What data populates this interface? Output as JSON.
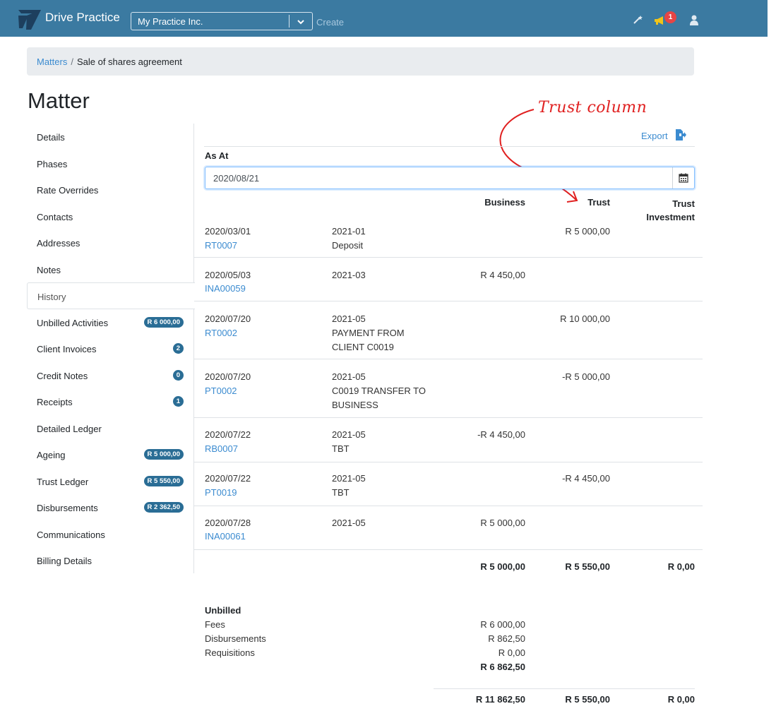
{
  "nav": {
    "brand": "Drive Practice",
    "practice": "My Practice Inc.",
    "create": "Create",
    "notification_count": "1",
    "colors": {
      "bar": "#3b7aa1",
      "badge": "#e64545"
    }
  },
  "breadcrumb": {
    "parent": "Matters",
    "current": "Sale of shares agreement"
  },
  "page_title": "Matter",
  "annotation": "Trust column",
  "sidebar": {
    "items": [
      {
        "label": "Details"
      },
      {
        "label": "Phases"
      },
      {
        "label": "Rate Overrides"
      },
      {
        "label": "Contacts"
      },
      {
        "label": "Addresses"
      },
      {
        "label": "Notes"
      },
      {
        "label": "History",
        "active": true
      },
      {
        "label": "Unbilled Activities",
        "badge": "R 6 000,00"
      },
      {
        "label": "Client Invoices",
        "badge": "2"
      },
      {
        "label": "Credit Notes",
        "badge": "0"
      },
      {
        "label": "Receipts",
        "badge": "1"
      },
      {
        "label": "Detailed Ledger"
      },
      {
        "label": "Ageing",
        "badge": "R 5 000,00"
      },
      {
        "label": "Trust Ledger",
        "badge": "R 5 550,00"
      },
      {
        "label": "Disbursements",
        "badge": "R 2 362,50"
      },
      {
        "label": "Communications"
      },
      {
        "label": "Billing Details"
      }
    ]
  },
  "history": {
    "export": "Export",
    "as_at_label": "As At",
    "as_at_value": "2020/08/21",
    "columns": {
      "business": "Business",
      "trust": "Trust",
      "trust_investment": "Trust Investment"
    },
    "rows": [
      {
        "date": "2020/03/01",
        "ref": "RT0007",
        "period": "2021-01",
        "desc": [
          "Deposit"
        ],
        "business": "",
        "trust": "R 5 000,00"
      },
      {
        "date": "2020/05/03",
        "ref": "INA00059",
        "period": "2021-03",
        "desc": [],
        "business": "R 4 450,00",
        "trust": ""
      },
      {
        "date": "2020/07/20",
        "ref": "RT0002",
        "period": "2021-05",
        "desc": [
          "PAYMENT FROM",
          "CLIENT C0019"
        ],
        "business": "",
        "trust": "R 10 000,00"
      },
      {
        "date": "2020/07/20",
        "ref": "PT0002",
        "period": "2021-05",
        "desc": [
          "C0019 TRANSFER TO",
          "BUSINESS"
        ],
        "business": "",
        "trust": "-R 5 000,00"
      },
      {
        "date": "2020/07/22",
        "ref": "RB0007",
        "period": "2021-05",
        "desc": [
          "TBT"
        ],
        "business": "-R 4 450,00",
        "trust": ""
      },
      {
        "date": "2020/07/22",
        "ref": "PT0019",
        "period": "2021-05",
        "desc": [
          "TBT"
        ],
        "business": "",
        "trust": "-R 4 450,00"
      },
      {
        "date": "2020/07/28",
        "ref": "INA00061",
        "period": "2021-05",
        "desc": [],
        "business": "R 5 000,00",
        "trust": ""
      }
    ],
    "totals": {
      "business": "R 5 000,00",
      "trust": "R 5 550,00",
      "trust_investment": "R 0,00"
    },
    "unbilled": {
      "heading": "Unbilled",
      "fees_label": "Fees",
      "fees": "R 6 000,00",
      "disb_label": "Disbursements",
      "disb": "R 862,50",
      "req_label": "Requisitions",
      "req": "R 0,00",
      "subtotal": "R 6 862,50"
    },
    "grand_totals": {
      "business": "R 11 862,50",
      "trust": "R 5 550,00",
      "trust_investment": "R 0,00"
    }
  }
}
